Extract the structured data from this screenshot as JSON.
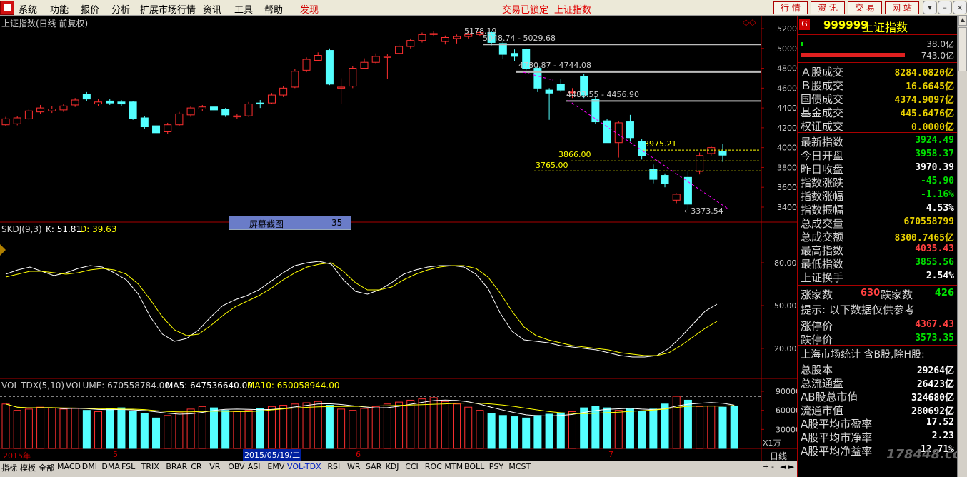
{
  "menu": [
    "系统",
    "功能",
    "报价",
    "分析",
    "扩展市场行情",
    "资讯",
    "工具",
    "帮助",
    "发现"
  ],
  "status": {
    "locked": "交易已锁定",
    "index": "上证指数"
  },
  "top_buttons": [
    "行 情",
    "资 讯",
    "交 易",
    "网 站"
  ],
  "chart": {
    "title": "上证指数(日线 前复权)",
    "price_ticks": [
      "5200",
      "5000",
      "4800",
      "4600",
      "4400",
      "4200",
      "4000",
      "3800",
      "3600",
      "3400"
    ],
    "price_values": [
      5200,
      5000,
      4800,
      4600,
      4400,
      4200,
      4000,
      3800,
      3600,
      3400
    ],
    "annotations": [
      {
        "text": "5178.19"
      },
      {
        "text": "5048.74 - 5029.68"
      },
      {
        "text": "4780.87 - 4744.08"
      },
      {
        "text": "4483.55 - 4456.90"
      },
      {
        "text": "3975.21"
      },
      {
        "text": "3866.00"
      },
      {
        "text": "3765.00"
      },
      {
        "text": "3373.54"
      }
    ],
    "screenshot_box": {
      "label": "屏幕截图",
      "value": "35"
    },
    "kdj_title": "SKDJ(9,3)",
    "kdj_k": "K: 51.81",
    "kdj_d": "D: 39.63",
    "kdj_ticks": [
      "80.00",
      "50.00",
      "20.00"
    ],
    "vol_title": "VOL-TDX(5,10)",
    "vol_text": "VOLUME: 670558784.00",
    "vol_ma5": "MA5: 647536640.00",
    "vol_ma10": "MA10: 650058944.00",
    "vol_ticks": [
      "90000",
      "60000",
      "30000"
    ],
    "vol_unit": "X1万",
    "date_labels": [
      "2015年",
      "5",
      "2015/05/19/二",
      "6",
      "7"
    ],
    "period": "日线"
  },
  "colors": {
    "up": "#ff3030",
    "down": "#54ffff",
    "k_line": "#ffffff",
    "d_line": "#ffff00",
    "trend": "#ff00ff"
  },
  "tabs": [
    "指标",
    "模板",
    "全部",
    "MACD",
    "DMI",
    "DMA",
    "FSL",
    "TRIX",
    "BRAR",
    "CR",
    "VR",
    "OBV",
    "ASI",
    "EMV",
    "VOL-TDX",
    "RSI",
    "WR",
    "SAR",
    "KDJ",
    "CCI",
    "ROC",
    "MTM",
    "BOLL",
    "PSY",
    "MCST"
  ],
  "right": {
    "code": "999999",
    "name": "上证指数",
    "badge": "G",
    "bar1": "38.0亿",
    "bar2": "743.0亿",
    "rows1": [
      {
        "label": "Ａ股成交",
        "value": "8284.0820亿",
        "color": "y"
      },
      {
        "label": "Ｂ股成交",
        "value": "16.6645亿",
        "color": "y"
      },
      {
        "label": "国债成交",
        "value": "4374.9097亿",
        "color": "y"
      },
      {
        "label": "基金成交",
        "value": "445.6476亿",
        "color": "y"
      },
      {
        "label": "权证成交",
        "value": "0.0000亿",
        "color": "y"
      }
    ],
    "rows2": [
      {
        "label": "最新指数",
        "value": "3924.49",
        "color": "g"
      },
      {
        "label": "今日开盘",
        "value": "3958.37",
        "color": "g"
      },
      {
        "label": "昨日收盘",
        "value": "3970.39",
        "color": "w"
      },
      {
        "label": "指数涨跌",
        "value": "-45.90",
        "color": "g"
      },
      {
        "label": "指数涨幅",
        "value": "-1.16%",
        "color": "g"
      },
      {
        "label": "指数振幅",
        "value": "4.53%",
        "color": "w"
      },
      {
        "label": "总成交量",
        "value": "670558799",
        "color": "y"
      },
      {
        "label": "总成交额",
        "value": "8300.7465亿",
        "color": "y"
      },
      {
        "label": "最高指数",
        "value": "4035.43",
        "color": "r"
      },
      {
        "label": "最低指数",
        "value": "3855.56",
        "color": "g"
      },
      {
        "label": "上证换手",
        "value": "2.54%",
        "color": "w"
      }
    ],
    "up_label": "涨家数",
    "up_count": "630",
    "down_label": "跌家数",
    "down_count": "426",
    "hint": "提示: 以下数据仅供参考",
    "rows3": [
      {
        "label": "涨停价",
        "value": "4367.43",
        "color": "r"
      },
      {
        "label": "跌停价",
        "value": "3573.35",
        "color": "g"
      }
    ],
    "stat_title": "上海市场统计 含B股,除H股:",
    "rows4": [
      {
        "label": "总股本",
        "value": "29264亿",
        "color": "w"
      },
      {
        "label": "总流通盘",
        "value": "26423亿",
        "color": "w"
      },
      {
        "label": "AB股总市值",
        "value": "324680亿",
        "color": "w"
      },
      {
        "label": "流通市值",
        "value": "280692亿",
        "color": "w"
      },
      {
        "label": "A股平均市盈率",
        "value": "17.52",
        "color": "w"
      },
      {
        "label": "A股平均市净率",
        "value": "2.23",
        "color": "w"
      },
      {
        "label": "A股平均净益率",
        "value": "12.71%",
        "color": "w"
      }
    ],
    "watermark": "178448.com"
  },
  "candles": [
    {
      "o": 4230,
      "c": 4290,
      "h": 4310,
      "l": 4220
    },
    {
      "o": 4240,
      "c": 4300,
      "h": 4320,
      "l": 4225
    },
    {
      "o": 4290,
      "c": 4370,
      "h": 4390,
      "l": 4280
    },
    {
      "o": 4360,
      "c": 4400,
      "h": 4430,
      "l": 4340
    },
    {
      "o": 4370,
      "c": 4390,
      "h": 4420,
      "l": 4350
    },
    {
      "o": 4380,
      "c": 4420,
      "h": 4440,
      "l": 4360
    },
    {
      "o": 4430,
      "c": 4480,
      "h": 4500,
      "l": 4410
    },
    {
      "o": 4540,
      "c": 4490,
      "h": 4560,
      "l": 4470
    },
    {
      "o": 4440,
      "c": 4460,
      "h": 4490,
      "l": 4420
    },
    {
      "o": 4470,
      "c": 4450,
      "h": 4490,
      "l": 4430
    },
    {
      "o": 4460,
      "c": 4440,
      "h": 4480,
      "l": 4420
    },
    {
      "o": 4460,
      "c": 4290,
      "h": 4470,
      "l": 4280
    },
    {
      "o": 4300,
      "c": 4210,
      "h": 4320,
      "l": 4190
    },
    {
      "o": 4220,
      "c": 4150,
      "h": 4240,
      "l": 4130
    },
    {
      "o": 4160,
      "c": 4230,
      "h": 4250,
      "l": 4140
    },
    {
      "o": 4230,
      "c": 4340,
      "h": 4360,
      "l": 4220
    },
    {
      "o": 4330,
      "c": 4400,
      "h": 4420,
      "l": 4310
    },
    {
      "o": 4390,
      "c": 4410,
      "h": 4430,
      "l": 4370
    },
    {
      "o": 4410,
      "c": 4380,
      "h": 4420,
      "l": 4360
    },
    {
      "o": 4390,
      "c": 4330,
      "h": 4400,
      "l": 4310
    },
    {
      "o": 4310,
      "c": 4320,
      "h": 4340,
      "l": 4290
    },
    {
      "o": 4320,
      "c": 4440,
      "h": 4460,
      "l": 4310
    },
    {
      "o": 4450,
      "c": 4440,
      "h": 4480,
      "l": 4400
    },
    {
      "o": 4450,
      "c": 4530,
      "h": 4550,
      "l": 4440
    },
    {
      "o": 4530,
      "c": 4600,
      "h": 4620,
      "l": 4510
    },
    {
      "o": 4610,
      "c": 4770,
      "h": 4790,
      "l": 4600
    },
    {
      "o": 4780,
      "c": 4890,
      "h": 4910,
      "l": 4760
    },
    {
      "o": 4880,
      "c": 4930,
      "h": 4960,
      "l": 4870
    },
    {
      "o": 4980,
      "c": 4640,
      "h": 5000,
      "l": 4630
    },
    {
      "o": 4600,
      "c": 4610,
      "h": 4700,
      "l": 4440
    },
    {
      "o": 4620,
      "c": 4800,
      "h": 4820,
      "l": 4600
    },
    {
      "o": 4800,
      "c": 4860,
      "h": 4900,
      "l": 4790
    },
    {
      "o": 4860,
      "c": 4920,
      "h": 4950,
      "l": 4850
    },
    {
      "o": 4910,
      "c": 4920,
      "h": 4940,
      "l": 4690
    },
    {
      "o": 4950,
      "c": 5020,
      "h": 5040,
      "l": 4940
    },
    {
      "o": 5020,
      "c": 5080,
      "h": 5100,
      "l": 5000
    },
    {
      "o": 5080,
      "c": 5140,
      "h": 5160,
      "l": 5060
    },
    {
      "o": 5140,
      "c": 5150,
      "h": 5175,
      "l": 5120
    },
    {
      "o": 5070,
      "c": 5110,
      "h": 5130,
      "l": 5040
    },
    {
      "o": 5100,
      "c": 5120,
      "h": 5140,
      "l": 5050
    },
    {
      "o": 5120,
      "c": 5140,
      "h": 5160,
      "l": 5100
    },
    {
      "o": 5140,
      "c": 5160,
      "h": 5178,
      "l": 5120
    },
    {
      "o": 5160,
      "c": 5060,
      "h": 5178,
      "l": 5030
    },
    {
      "o": 5050,
      "c": 4940,
      "h": 5070,
      "l": 4890
    },
    {
      "o": 4950,
      "c": 4920,
      "h": 4990,
      "l": 4870
    },
    {
      "o": 4990,
      "c": 4800,
      "h": 5000,
      "l": 4780
    },
    {
      "o": 4800,
      "c": 4600,
      "h": 4830,
      "l": 4560
    },
    {
      "o": 4580,
      "c": 4550,
      "h": 4600,
      "l": 4280
    },
    {
      "o": 4640,
      "c": 4580,
      "h": 4690,
      "l": 4560
    },
    {
      "o": 4560,
      "c": 4560,
      "h": 4600,
      "l": 4500
    },
    {
      "o": 4720,
      "c": 4530,
      "h": 4740,
      "l": 4500
    },
    {
      "o": 4490,
      "c": 4260,
      "h": 4510,
      "l": 4240
    },
    {
      "o": 4270,
      "c": 4050,
      "h": 4290,
      "l": 4050
    },
    {
      "o": 4050,
      "c": 4250,
      "h": 4270,
      "l": 3900
    },
    {
      "o": 4260,
      "c": 4100,
      "h": 4330,
      "l": 4060
    },
    {
      "o": 4060,
      "c": 3920,
      "h": 4090,
      "l": 3880
    },
    {
      "o": 3780,
      "c": 3680,
      "h": 3830,
      "l": 3640
    },
    {
      "o": 3720,
      "c": 3640,
      "h": 3740,
      "l": 3600
    },
    {
      "o": 3470,
      "c": 3530,
      "h": 3540,
      "l": 3440
    },
    {
      "o": 3700,
      "c": 3430,
      "h": 3760,
      "l": 3373
    },
    {
      "o": 3760,
      "c": 3920,
      "h": 3950,
      "l": 3730
    },
    {
      "o": 3940,
      "c": 4000,
      "h": 4020,
      "l": 3920
    },
    {
      "o": 3958,
      "c": 3924,
      "h": 4035,
      "l": 3856
    }
  ],
  "kdj_k": [
    72,
    75,
    77,
    74,
    71,
    73,
    76,
    78,
    77,
    73,
    68,
    58,
    42,
    30,
    25,
    27,
    33,
    42,
    50,
    54,
    57,
    61,
    67,
    73,
    78,
    80,
    81,
    79,
    68,
    60,
    58,
    61,
    66,
    72,
    75,
    77,
    78,
    78,
    77,
    72,
    62,
    45,
    32,
    26,
    25,
    24,
    22,
    21,
    20,
    19,
    17,
    15,
    14,
    14,
    15,
    20,
    28,
    37,
    46,
    51
  ],
  "kdj_d": [
    70,
    72,
    74,
    74,
    73,
    72,
    73,
    75,
    76,
    75,
    72,
    65,
    54,
    42,
    33,
    29,
    30,
    36,
    43,
    49,
    53,
    57,
    62,
    68,
    73,
    77,
    79,
    80,
    74,
    66,
    61,
    61,
    63,
    68,
    72,
    75,
    77,
    78,
    78,
    76,
    70,
    59,
    46,
    35,
    29,
    26,
    24,
    22,
    21,
    20,
    19,
    17,
    16,
    15,
    15,
    17,
    22,
    28,
    34,
    39
  ],
  "vols": [
    70000,
    60000,
    62000,
    65000,
    64000,
    62000,
    63000,
    60000,
    58000,
    62000,
    64000,
    59000,
    55000,
    48000,
    52000,
    56000,
    62000,
    66000,
    64000,
    60000,
    58000,
    60000,
    63000,
    66000,
    68000,
    70000,
    72000,
    74000,
    68000,
    62000,
    60000,
    63000,
    66000,
    70000,
    73000,
    76000,
    78000,
    80000,
    74000,
    70000,
    65000,
    60000,
    55000,
    52000,
    50000,
    48000,
    52000,
    54000,
    56000,
    58000,
    64000,
    66000,
    64000,
    60000,
    62000,
    58000,
    62000,
    70000,
    82000,
    76000,
    66000,
    67000,
    65000,
    67000
  ]
}
